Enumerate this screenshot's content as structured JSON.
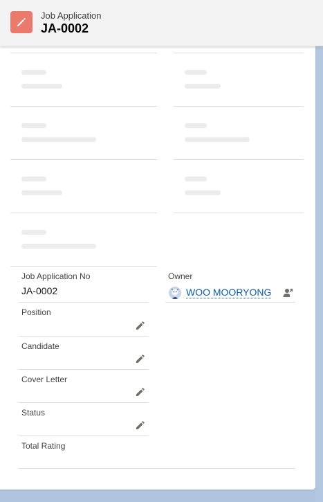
{
  "header": {
    "object_label": "Job Application",
    "record_name": "JA-0002",
    "icon": "pencil-icon",
    "icon_color": "#ea7a6b"
  },
  "fields": {
    "job_application_no": {
      "label": "Job Application No",
      "value": "JA-0002"
    },
    "owner": {
      "label": "Owner",
      "value": "WOO MOORYONG",
      "icon": "user-avatar-icon",
      "action_icon": "change-owner-icon"
    },
    "position": {
      "label": "Position",
      "value": ""
    },
    "candidate": {
      "label": "Candidate",
      "value": ""
    },
    "cover_letter": {
      "label": "Cover Letter",
      "value": ""
    },
    "status": {
      "label": "Status",
      "value": ""
    },
    "total_rating": {
      "label": "Total Rating",
      "value": ""
    }
  },
  "colors": {
    "link": "#0b5cab",
    "background": "#b0c4df",
    "skeleton": "#ececec"
  }
}
